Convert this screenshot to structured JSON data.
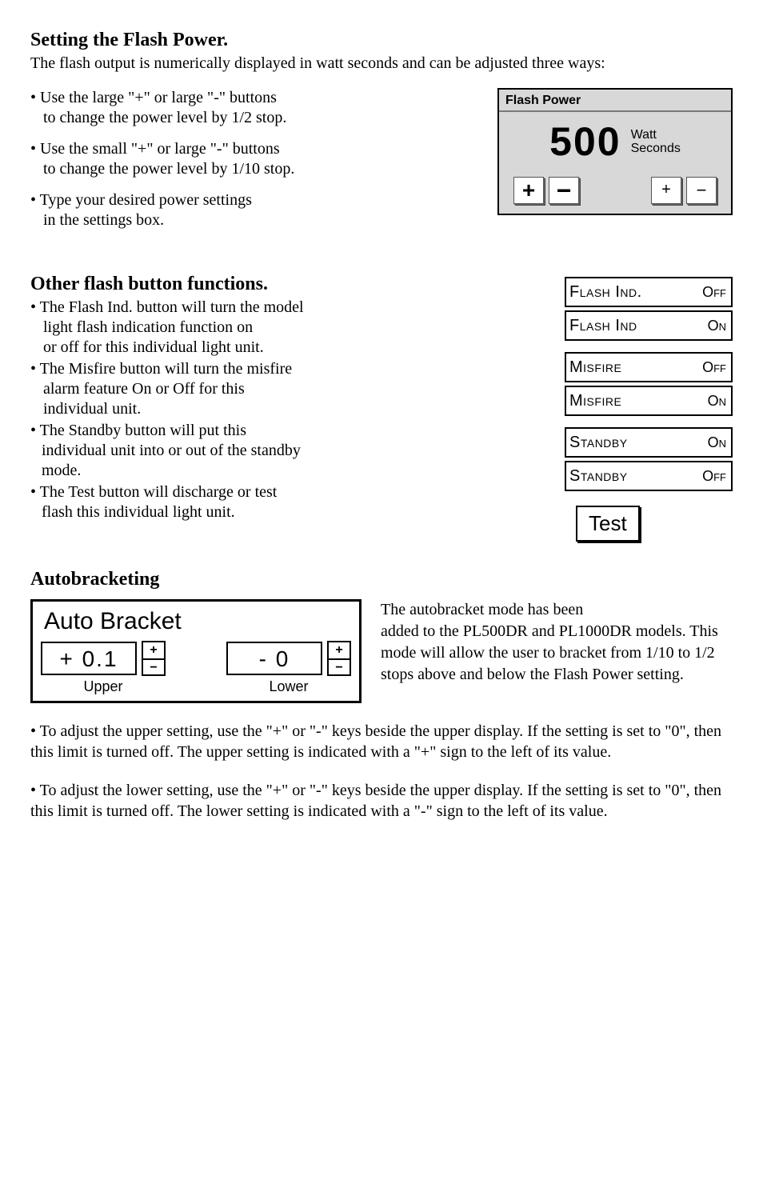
{
  "sec1": {
    "heading": "Setting the Flash Power.",
    "intro": "The flash output is numerically displayed in watt seconds and can be adjusted three ways:",
    "bullets": [
      [
        "• Use the large \"+\" or large \"-\" buttons",
        "to change the power level by 1/2 stop."
      ],
      [
        "• Use the small \"+\" or large \"-\" buttons",
        "to change the power level by 1/10 stop."
      ],
      [
        "• Type your desired power settings",
        "in the settings box."
      ]
    ]
  },
  "flash_power": {
    "title": "Flash Power",
    "value": "500",
    "unit_l1": "Watt",
    "unit_l2": "Seconds",
    "large_plus": "+",
    "large_minus": "−",
    "small_plus": "+",
    "small_minus": "−"
  },
  "sec2": {
    "heading": "Other flash button functions.",
    "bullets": [
      [
        "• The Flash Ind. button will turn the model",
        "light flash indication function on",
        "or off for this individual light unit."
      ],
      [
        "• The Misfire button will turn the misfire",
        "alarm feature On or Off for this",
        "individual unit."
      ],
      [
        "• The Standby button will put this",
        "individual unit into or out of the standby",
        "mode."
      ],
      [
        "• The Test button will discharge or test",
        "flash this individual light unit."
      ]
    ]
  },
  "status": {
    "flash_ind_off_label": "Flash Ind.",
    "flash_ind_off_state": "Off",
    "flash_ind_on_label": "Flash Ind",
    "flash_ind_on_state": "On",
    "misfire_off_label": "Misfire",
    "misfire_off_state": "Off",
    "misfire_on_label": "Misfire",
    "misfire_on_state": "On",
    "standby_on_label": "Standby",
    "standby_on_state": "On",
    "standby_off_label": "Standby",
    "standby_off_state": "Off",
    "test": "Test"
  },
  "sec3": {
    "heading": "Autobracketing",
    "panel_title": "Auto Bracket",
    "upper_value": "+ 0.1",
    "upper_label": "Upper",
    "lower_value": "-   0",
    "lower_label": "Lower",
    "step_plus": "+",
    "step_minus": "−",
    "side_text_l1": "The autobracket mode has been",
    "side_text_l2": "added to the PL500DR and PL1000DR models.  This mode will allow the user to bracket from 1/10 to 1/2 stops above and below the Flash Power setting."
  },
  "para1": "•  To adjust the upper setting, use the \"+\" or \"-\" keys beside the upper display.  If the setting is set to \"0\", then this limit is turned off.  The upper setting is indicated with a \"+\" sign to the left of its value.",
  "para2": "•  To adjust the lower setting, use the \"+\" or \"-\" keys beside the upper display.  If the setting is set to \"0\", then this limit is turned off.  The lower setting is indicated with a \"-\" sign to the left of its value."
}
